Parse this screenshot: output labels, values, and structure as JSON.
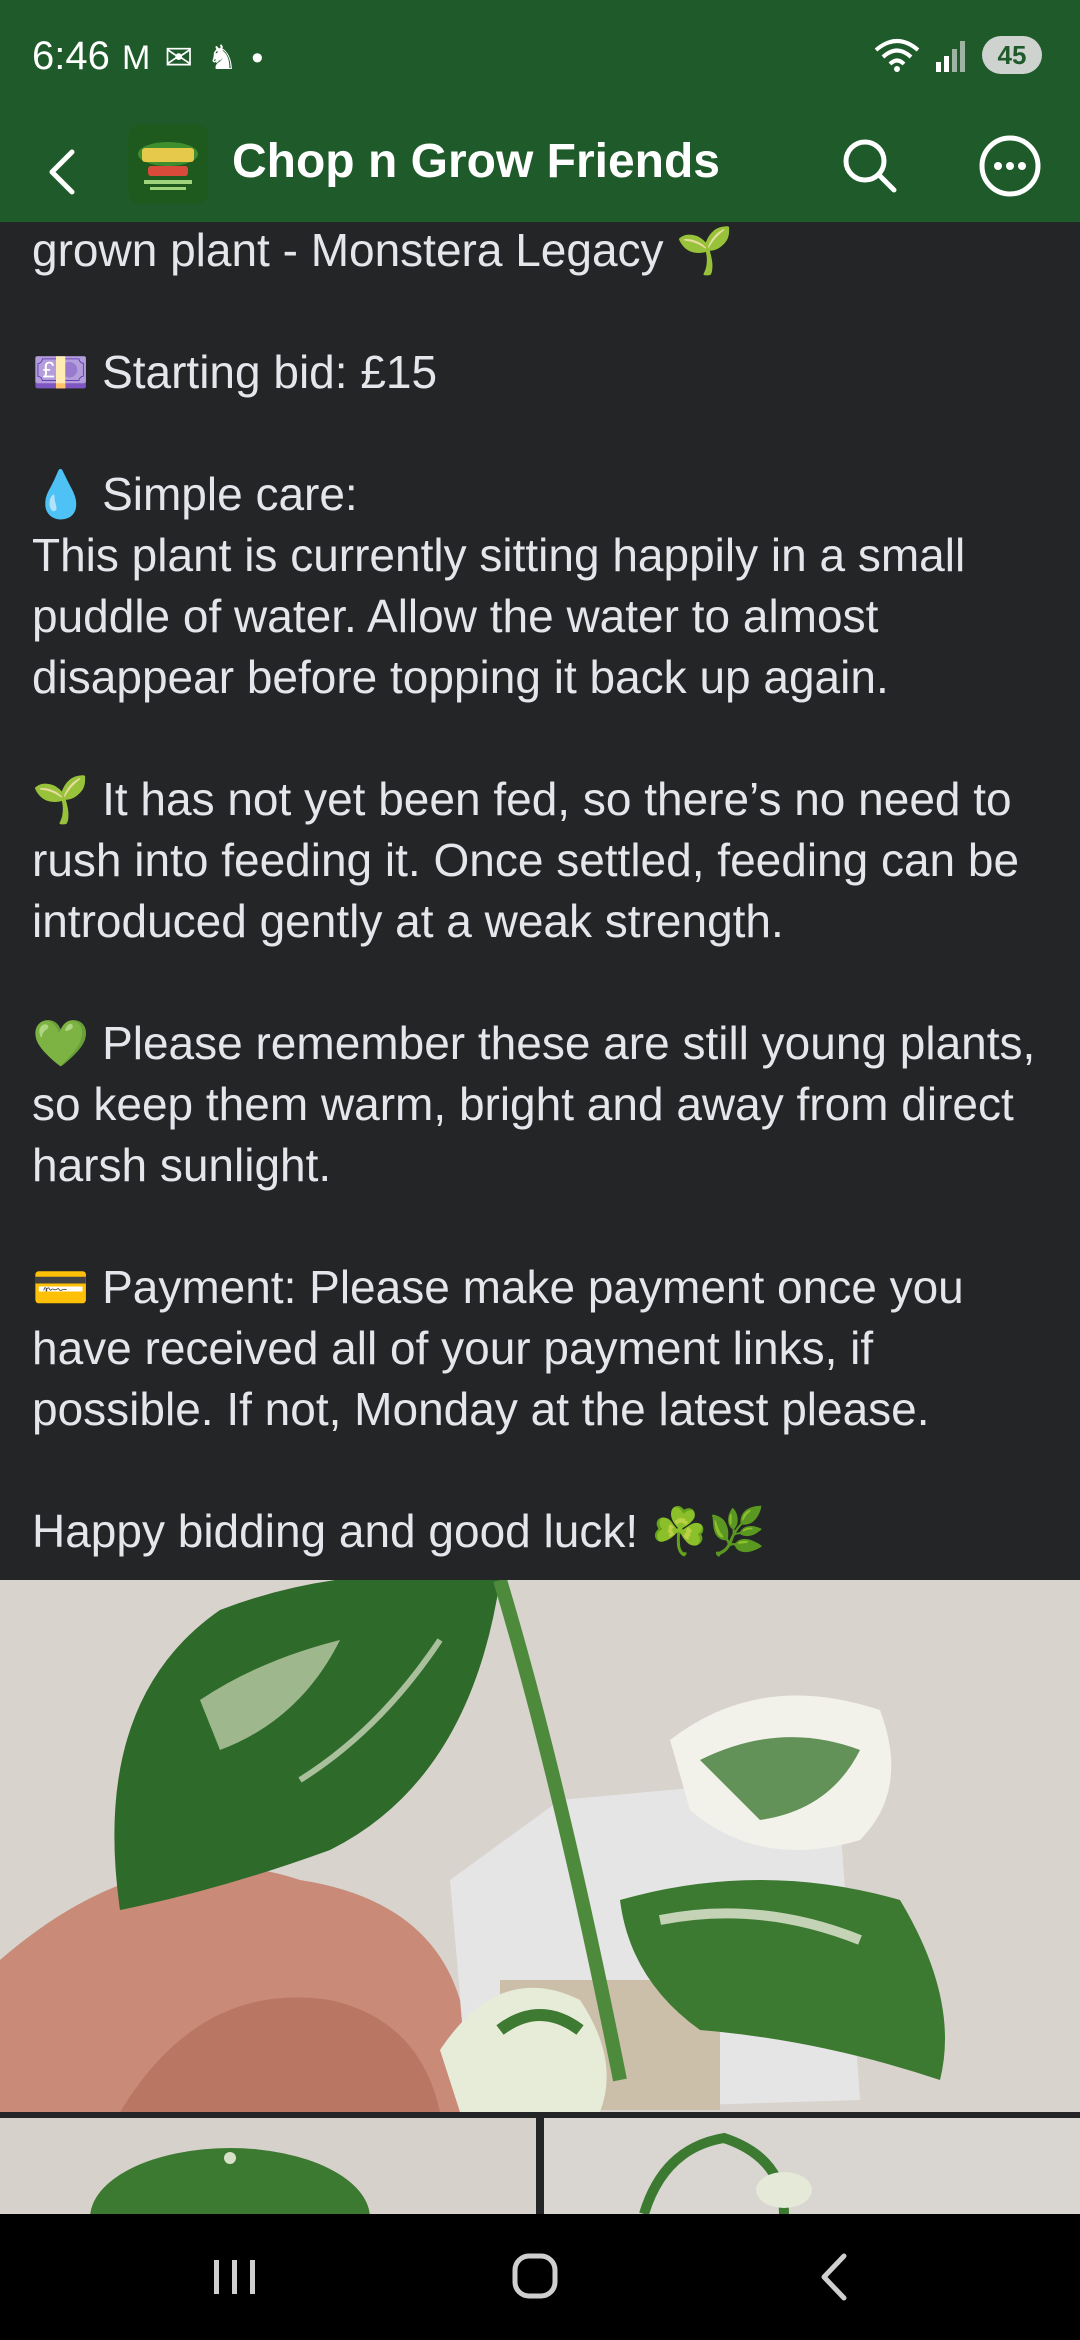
{
  "status_bar": {
    "time": "6:46",
    "battery": "45",
    "notification_icons": [
      "M",
      "✉",
      "♞",
      "•"
    ]
  },
  "header": {
    "title": "Chop n Grow Friends"
  },
  "post": {
    "paragraphs": [
      {
        "emoji": "",
        "text": "grown plant - Monstera Legacy",
        "trailing_emoji": "🌱"
      },
      {
        "emoji": "💷",
        "text": "Starting bid: £15"
      },
      {
        "emoji": "💧",
        "text": "Simple care:",
        "body": "This plant is currently sitting happily in a small puddle of water. Allow the water to almost disappear before topping it back up again."
      },
      {
        "emoji": "🌱",
        "text": "It has not yet been fed, so there’s no need to rush into feeding it. Once settled, feeding can be introduced gently at a weak strength."
      },
      {
        "emoji": "💚",
        "text": "Please remember these are still young plants, so keep them warm, bright and away from direct harsh sunlight."
      },
      {
        "emoji": "💳",
        "text": "Payment: Please make payment once you have received all of your payment links, if possible. If not, Monday at the latest please."
      },
      {
        "emoji": "",
        "text": "Happy bidding and good luck!",
        "trailing_emoji": "☘️🌿"
      }
    ]
  },
  "colors": {
    "header_bg": "#1f5a2a",
    "page_bg": "#242526",
    "text": "#e4e6eb"
  }
}
